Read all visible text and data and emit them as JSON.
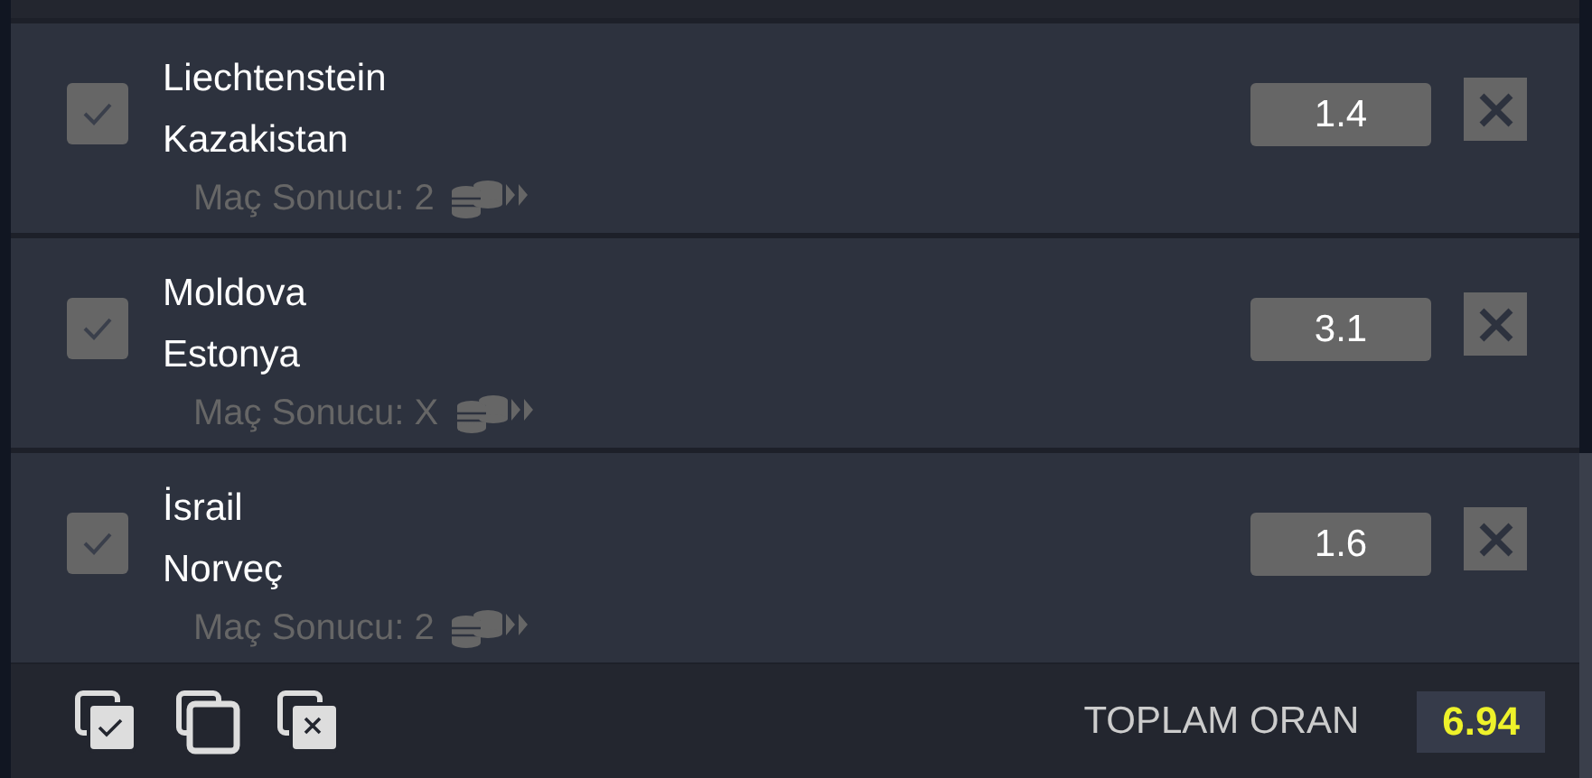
{
  "bets": [
    {
      "home": "Liechtenstein",
      "away": "Kazakistan",
      "market": "Maç Sonucu: 2",
      "odds": "1.4",
      "checked": true
    },
    {
      "home": "Moldova",
      "away": "Estonya",
      "market": "Maç Sonucu: X",
      "odds": "3.1",
      "checked": true
    },
    {
      "home": "İsrail",
      "away": "Norveç",
      "market": "Maç Sonucu: 2",
      "odds": "1.6",
      "checked": true
    }
  ],
  "total": {
    "label": "TOPLAM ORAN",
    "value": "6.94"
  }
}
